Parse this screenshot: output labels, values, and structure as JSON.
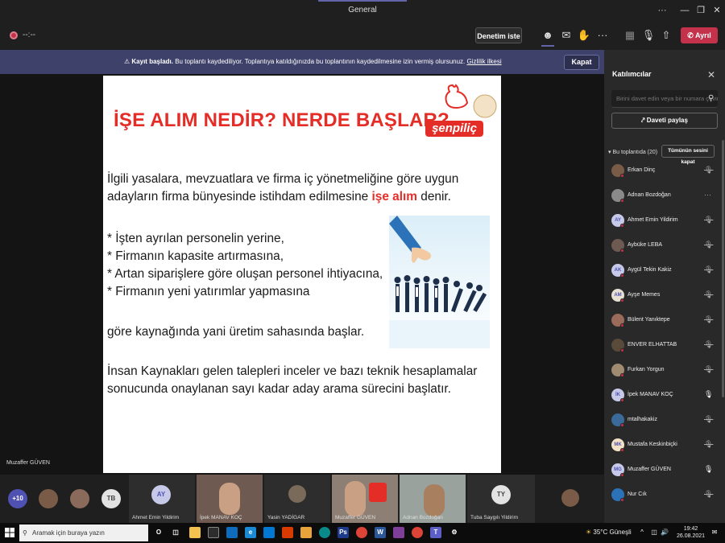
{
  "window": {
    "title": "General"
  },
  "toolbar": {
    "timer": "--:--",
    "request_control_label": "Denetim iste",
    "leave_label": "Ayrıl"
  },
  "banner": {
    "title": "Kayıt başladı.",
    "message": "Bu toplantı kaydediliyor. Toplantıya katıldığınızda bu toplantının kaydedilmesine izin vermiş olursunuz.",
    "privacy_link": "Gizlilik ilkesi",
    "close_label": "Kapat"
  },
  "slide": {
    "heading": "İŞE ALIM NEDİR? NERDE BAŞLAR?",
    "logo_text": "şenpiliç",
    "para1_line1": "İlgili yasalara, mevzuatlara ve firma iç yönetmeliğine göre uygun",
    "para1_line2_pre": "adayların firma bünyesinde istihdam edilmesine ",
    "para1_line2_highlight": "işe alım",
    "para1_line2_post": " denir.",
    "bullets": [
      "* İşten ayrılan personelin yerine,",
      "* Firmanın kapasite artırmasına,",
      "* Artan siparişlere göre oluşan personel ihtiyacına,",
      "* Firmanın yeni yatırımlar yapmasına"
    ],
    "para2": "göre kaynağında yani üretim sahasında başlar.",
    "para3_line1": "İnsan Kaynakları gelen talepleri inceler ve bazı teknik hesaplamalar",
    "para3_line2": "sonucunda onaylanan sayı kadar aday arama sürecini başlatır."
  },
  "stage": {
    "presenter_name": "Muzaffer GÜVEN"
  },
  "strip": {
    "overflow_count": "+10",
    "avatar_tb": "TB",
    "tiles": [
      {
        "initials": "AY",
        "name": "Ahmet Emin Yildirim"
      },
      {
        "initials": "",
        "name": "İpek MANAV KOÇ"
      },
      {
        "initials": "",
        "name": "Yasin YADİGAR"
      },
      {
        "initials": "",
        "name": "Muzaffer GÜVEN"
      },
      {
        "initials": "",
        "name": "Adnan Bozdoğan"
      },
      {
        "initials": "TY",
        "name": "Tuba Saygılı Yildirim"
      }
    ]
  },
  "panel": {
    "title": "Katılımcılar",
    "search_placeholder": "Birini davet edin veya bir numara çevirin",
    "share_invite_label": "Daveti paylaş",
    "in_meeting_label": "Bu toplantıda (20)",
    "mute_all_label": "Tümünün sesini kapat",
    "participants": [
      {
        "name": "Erkan Dinç",
        "initials": "",
        "mic": "muted"
      },
      {
        "name": "Adnan Bozdoğan",
        "initials": "",
        "mic": "more"
      },
      {
        "name": "Ahmet Emin Yildirim",
        "initials": "AY",
        "mic": "muted"
      },
      {
        "name": "Aybüke LEBA",
        "initials": "",
        "mic": "muted"
      },
      {
        "name": "Aygül Tekin Kakiz",
        "initials": "AK",
        "mic": "muted"
      },
      {
        "name": "Ayşe Memes",
        "initials": "AM",
        "mic": "muted"
      },
      {
        "name": "Bülent Yanıktepe",
        "initials": "",
        "mic": "muted"
      },
      {
        "name": "ENVER ELHATTAB",
        "initials": "",
        "mic": "muted"
      },
      {
        "name": "Furkan Yorgun",
        "initials": "",
        "mic": "muted"
      },
      {
        "name": "İpek MANAV KOÇ",
        "initials": "İK",
        "mic": "on"
      },
      {
        "name": "mtalhakakiz",
        "initials": "",
        "mic": "muted"
      },
      {
        "name": "Mustafa Keskinbiçki",
        "initials": "MK",
        "mic": "muted"
      },
      {
        "name": "Muzaffer GÜVEN",
        "initials": "MG",
        "mic": "on"
      },
      {
        "name": "Nur Cık",
        "initials": "",
        "mic": "muted"
      }
    ]
  },
  "taskbar": {
    "search_placeholder": "Aramak için buraya yazın",
    "weather": "35°C Güneşli",
    "time": "19:42",
    "date": "26.08.2021"
  },
  "colors": {
    "accent": "#6264a7",
    "leave": "#c4314b",
    "slide_red": "#e52d27",
    "banner": "#3e4169"
  }
}
